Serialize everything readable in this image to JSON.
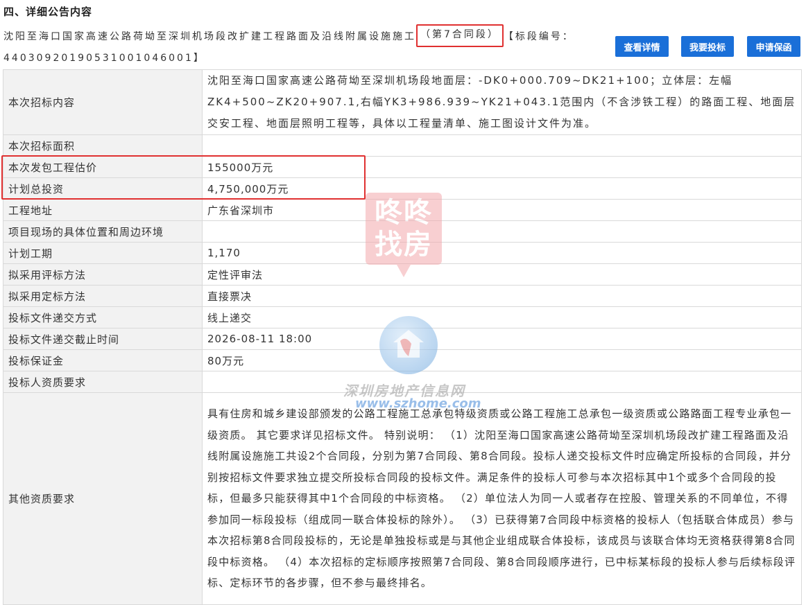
{
  "section": {
    "title": "四、详细公告内容"
  },
  "header": {
    "project_name_prefix": "沈阳至海口国家高速公路荷坳至深圳机场段改扩建工程路面及沿线附属设施施工",
    "contract_section": "（第7合同段）",
    "bid_code_label": "【标段编号：",
    "bid_code": "44030920190531001046001】"
  },
  "buttons": {
    "detail": "查看详情",
    "bid": "我要投标",
    "guarantee": "申请保函"
  },
  "table": {
    "rows": [
      {
        "label": "本次招标内容",
        "value": "沈阳至海口国家高速公路荷坳至深圳机场段地面层：-DK0+000.709~DK21+100；立体层：左幅ZK4+500~ZK20+907.1,右幅YK3+986.939~YK21+043.1范围内（不含涉铁工程）的路面工程、地面层交安工程、地面层照明工程等，具体以工程量清单、施工图设计文件为准。"
      },
      {
        "label": "本次招标面积",
        "value": ""
      },
      {
        "label": "本次发包工程估价",
        "value": "155000万元"
      },
      {
        "label": "计划总投资",
        "value": "4,750,000万元"
      },
      {
        "label": "工程地址",
        "value": "广东省深圳市"
      },
      {
        "label": "项目现场的具体位置和周边环境",
        "value": ""
      },
      {
        "label": "计划工期",
        "value": "1,170"
      },
      {
        "label": "拟采用评标方法",
        "value": "定性评审法"
      },
      {
        "label": "拟采用定标方法",
        "value": "直接票决"
      },
      {
        "label": "投标文件递交方式",
        "value": "线上递交"
      },
      {
        "label": "投标文件递交截止时间",
        "value": "2026-08-11 18:00"
      },
      {
        "label": "投标保证金",
        "value": "80万元"
      },
      {
        "label": "投标人资质要求",
        "value": ""
      },
      {
        "label": "其他资质要求",
        "value": "具有住房和城乡建设部颁发的公路工程施工总承包特级资质或公路工程施工总承包一级资质或公路路面工程专业承包一级资质。 其它要求详见招标文件。 特别说明： （1）沈阳至海口国家高速公路荷坳至深圳机场段改扩建工程路面及沿线附属设施施工共设2个合同段，分别为第7合同段、第8合同段。投标人递交投标文件时应确定所投标的合同段，并分别按招标文件要求独立提交所投标合同段的投标文件。满足条件的投标人可参与本次招标其中1个或多个合同段的投标，但最多只能获得其中1个合同段的中标资格。 （2）单位法人为同一人或者存在控股、管理关系的不同单位，不得参加同一标段投标（组成同一联合体投标的除外）。 （3）已获得第7合同段中标资格的投标人（包括联合体成员）参与本次招标第8合同段投标的，无论是单独投标或是与其他企业组成联合体投标，该成员与该联合体均无资格获得第8合同段中标资格。 （4）本次招标的定标顺序按照第7合同段、第8合同段顺序进行，已中标某标段的投标人参与后续标段评标、定标环节的各步骤，但不参与最终排名。"
      }
    ]
  },
  "watermarks": {
    "dongdong_line1": "咚咚",
    "dongdong_line2": "找房",
    "site_name": "深圳房地产信息网",
    "site_url": "www.szhome.com"
  },
  "colors": {
    "button_blue": "#1a6fd8",
    "highlight_red": "#e03030",
    "label_bg": "#f2f2f2",
    "border": "#d9d9d9"
  }
}
